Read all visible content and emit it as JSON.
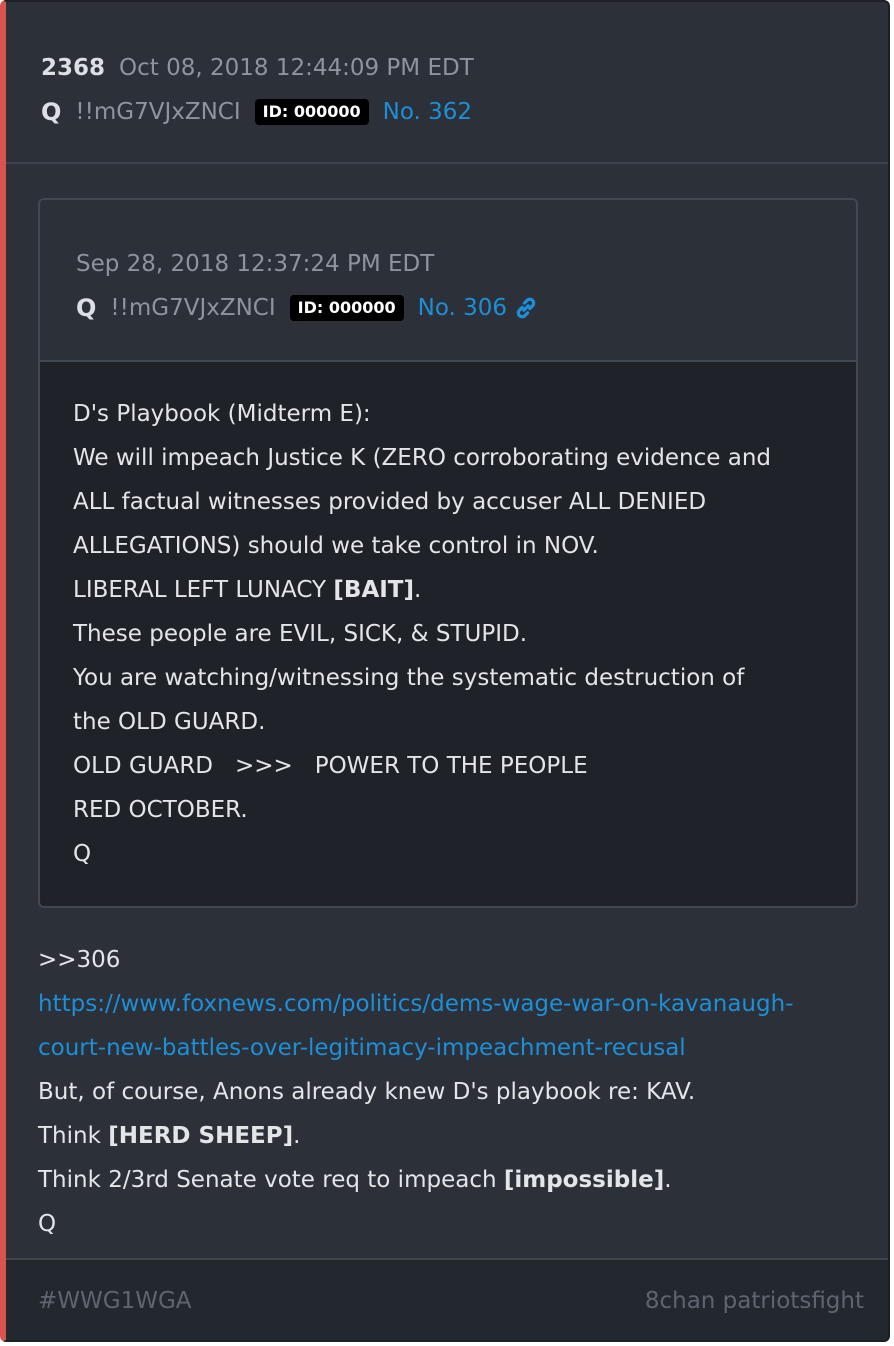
{
  "post": {
    "number": "2368",
    "date": "Oct 08, 2018 12:44:09 PM EDT",
    "author": "Q",
    "tripcode": "!!mG7VJxZNCI",
    "id_badge": "ID: 000000",
    "post_no": "No. 362"
  },
  "quote": {
    "date": "Sep 28, 2018 12:37:24 PM EDT",
    "author": "Q",
    "tripcode": "!!mG7VJxZNCI",
    "id_badge": "ID: 000000",
    "post_no": "No. 306",
    "link_icon": "link-icon",
    "lines": [
      "D's Playbook (Midterm E):",
      "We will impeach Justice K (ZERO corroborating evidence and",
      "ALL factual witnesses provided by accuser ALL DENIED",
      "ALLEGATIONS) should we take control in NOV.",
      "LIBERAL LEFT LUNACY ",
      "These people are EVIL, SICK, & STUPID.",
      "You are watching/witnessing the systematic destruction of",
      "the OLD GUARD.",
      "OLD GUARD   >>>   POWER TO THE PEOPLE",
      "RED OCTOBER.",
      "Q"
    ],
    "bait_bold": "[BAIT]",
    "bait_after": "."
  },
  "body": {
    "reply_ref": ">>306",
    "url_line1": "https://www.foxnews.com/politics/dems-wage-war-on-kavanaugh-",
    "url_line2": "court-new-battles-over-legitimacy-impeachment-recusal",
    "line1": "But, of course, Anons already knew D's playbook re: KAV.",
    "line2_pre": "Think ",
    "line2_bold": "[HERD SHEEP]",
    "line2_post": ".",
    "line3_pre": "Think 2/3rd Senate vote req to impeach ",
    "line3_bold": "[impossible]",
    "line3_post": ".",
    "signature": "Q"
  },
  "footer": {
    "hashtag": "#WWG1WGA",
    "source": "8chan patriotsfight"
  },
  "colors": {
    "accent_left_border": "#d9534f",
    "link": "#1e8fd6",
    "background": "#2b3039"
  }
}
